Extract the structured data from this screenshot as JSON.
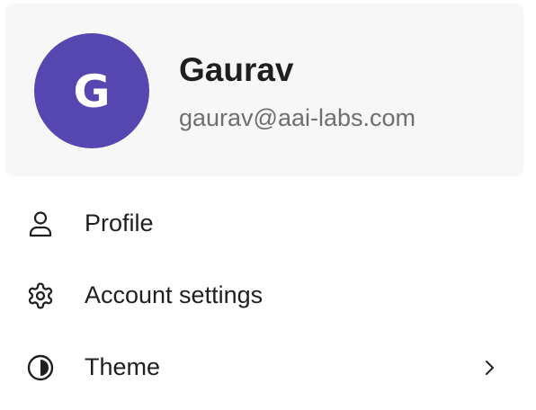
{
  "profile_card": {
    "avatar_initial": "G",
    "name": "Gaurav",
    "email": "gaurav@aai-labs.com",
    "avatar_color": "#5647b0"
  },
  "menu": {
    "items": [
      {
        "label": "Profile",
        "icon": "user-icon"
      },
      {
        "label": "Account settings",
        "icon": "gear-icon"
      },
      {
        "label": "Theme",
        "icon": "contrast-icon",
        "has_submenu": true
      }
    ]
  }
}
